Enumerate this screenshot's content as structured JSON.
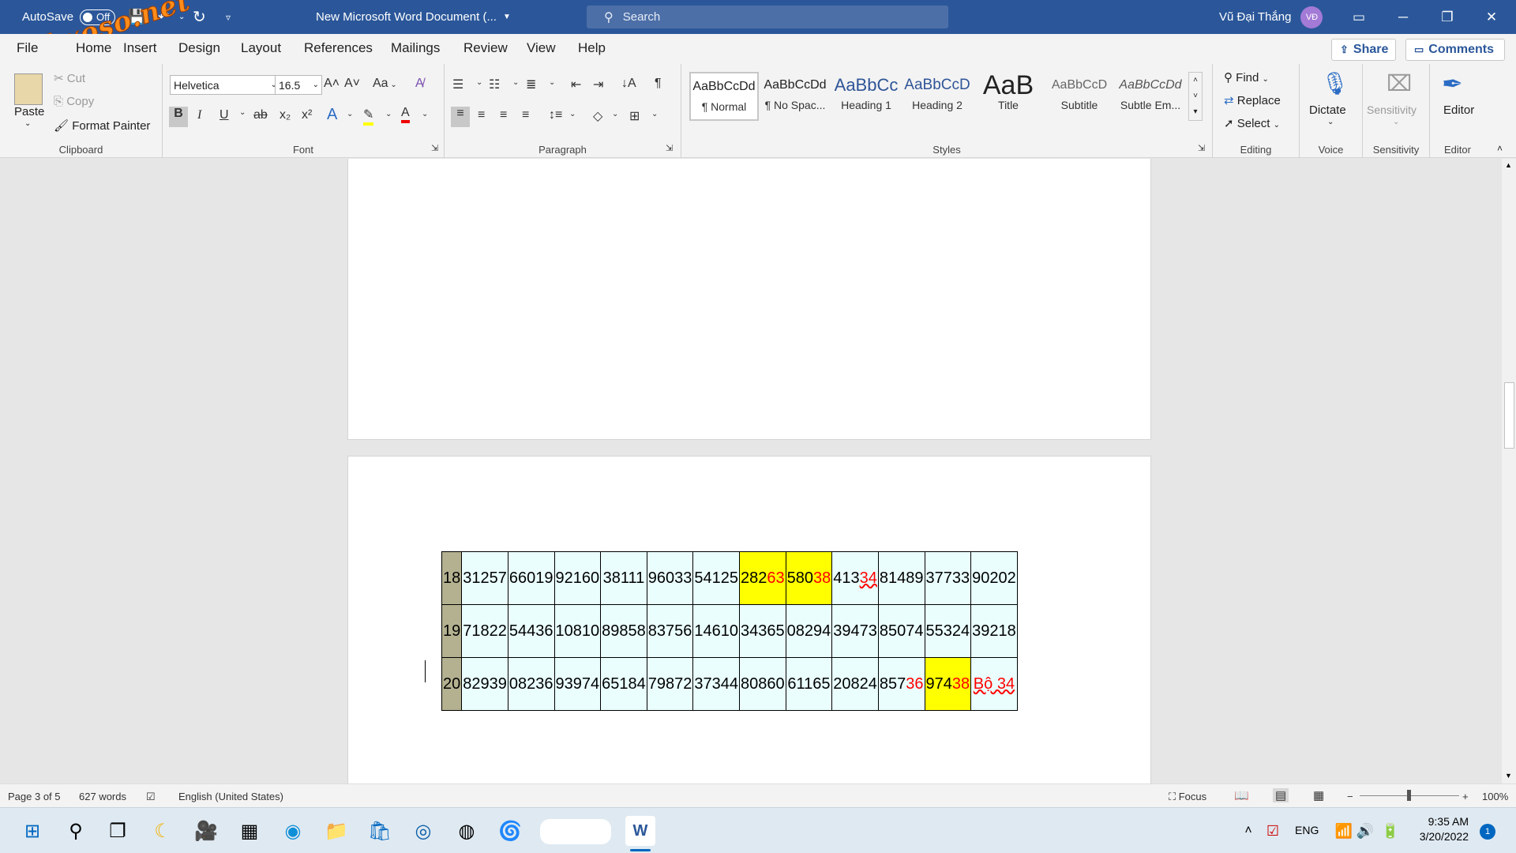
{
  "title_bar": {
    "autosave_label": "AutoSave",
    "autosave_state": "Off",
    "doc_title": "New Microsoft Word Document (...",
    "search_placeholder": "Search",
    "user_name": "Vũ Đại Thắng",
    "user_initials": "VĐ"
  },
  "watermark": "webxoso.net",
  "menu": {
    "tabs": [
      "File",
      "Home",
      "Insert",
      "Design",
      "Layout",
      "References",
      "Mailings",
      "Review",
      "View",
      "Help"
    ],
    "share_label": "Share",
    "comments_label": "Comments"
  },
  "ribbon": {
    "clipboard": {
      "paste": "Paste",
      "cut": "Cut",
      "copy": "Copy",
      "format_painter": "Format Painter",
      "group": "Clipboard"
    },
    "font": {
      "family": "Helvetica",
      "size": "16.5",
      "group": "Font",
      "case_label": "Aa"
    },
    "paragraph": {
      "group": "Paragraph"
    },
    "styles": {
      "group": "Styles",
      "items": [
        {
          "preview": "AaBbCcDd",
          "name": "¶ Normal"
        },
        {
          "preview": "AaBbCcDd",
          "name": "¶ No Spac..."
        },
        {
          "preview": "AaBbCc",
          "name": "Heading 1"
        },
        {
          "preview": "AaBbCcD",
          "name": "Heading 2"
        },
        {
          "preview": "AaB",
          "name": "Title"
        },
        {
          "preview": "AaBbCcD",
          "name": "Subtitle"
        },
        {
          "preview": "AaBbCcDd",
          "name": "Subtle Em..."
        }
      ]
    },
    "editing": {
      "find": "Find",
      "replace": "Replace",
      "select": "Select",
      "group": "Editing"
    },
    "voice": {
      "dictate": "Dictate",
      "group": "Voice"
    },
    "sensitivity": {
      "label": "Sensitivity",
      "group": "Sensitivity"
    },
    "editor": {
      "label": "Editor",
      "group": "Editor"
    }
  },
  "table": {
    "rows": [
      {
        "num": "18",
        "cells": [
          "31257",
          "66019",
          "92160",
          "38111",
          "96033",
          "54125",
          "28263",
          "58038",
          "41334",
          "81489",
          "37733",
          "90202"
        ]
      },
      {
        "num": "19",
        "cells": [
          "71822",
          "54436",
          "10810",
          "89858",
          "83756",
          "14610",
          "34365",
          "08294",
          "39473",
          "85074",
          "55324",
          "39218"
        ]
      },
      {
        "num": "20",
        "cells": [
          "82939",
          "08236",
          "93974",
          "65184",
          "79872",
          "37344",
          "80860",
          "61165",
          "20824",
          "85736",
          "97438",
          "Bộ 34"
        ]
      }
    ]
  },
  "status_bar": {
    "page": "Page 3 of 5",
    "words": "627 words",
    "language": "English (United States)",
    "focus": "Focus",
    "zoom": "100%"
  },
  "taskbar": {
    "language": "ENG",
    "time": "9:35 AM",
    "date": "3/20/2022",
    "notification_count": "1"
  },
  "colors": {
    "word_blue": "#2b579a",
    "highlight": "#ffff00",
    "table_row_bg": "#eafefe",
    "row_number_bg": "#b4b191",
    "red_digits": "#ff0000"
  }
}
